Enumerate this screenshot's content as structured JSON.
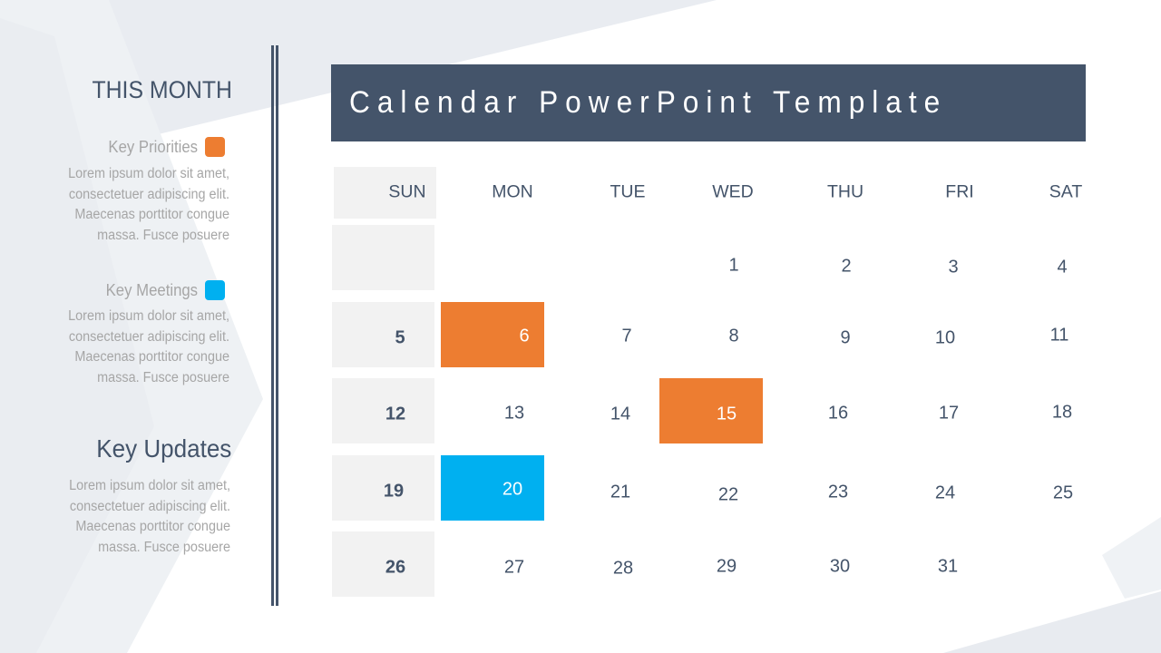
{
  "sidebar": {
    "heading": "THIS MONTH",
    "sections": [
      {
        "title": "Key Priorities",
        "marker_color": "#ed7d31",
        "body_lines": [
          "Lorem ipsum dolor sit amet,",
          "consectetuer adipiscing elit.",
          "Maecenas porttitor congue",
          "massa. Fusce posuere"
        ]
      },
      {
        "title": "Key Meetings",
        "marker_color": "#00b0f0",
        "body_lines": [
          "Lorem ipsum dolor sit amet,",
          "consectetuer adipiscing elit.",
          "Maecenas porttitor congue",
          "massa. Fusce posuere"
        ]
      }
    ],
    "updates": {
      "title": "Key Updates",
      "body_lines": [
        "Lorem ipsum dolor sit amet,",
        "consectetuer adipiscing elit.",
        "Maecenas porttitor congue",
        "massa. Fusce posuere"
      ]
    }
  },
  "banner": {
    "title": "Calendar PowerPoint Template"
  },
  "calendar": {
    "weekdays": [
      "SUN",
      "MON",
      "TUE",
      "WED",
      "THU",
      "FRI",
      "SAT"
    ],
    "weeks": [
      [
        "",
        "",
        "",
        "1",
        "2",
        "3",
        "4"
      ],
      [
        "5",
        "6",
        "7",
        "8",
        "9",
        "10",
        "11"
      ],
      [
        "12",
        "13",
        "14",
        "15",
        "16",
        "17",
        "18"
      ],
      [
        "19",
        "20",
        "21",
        "22",
        "23",
        "24",
        "25"
      ],
      [
        "26",
        "27",
        "28",
        "29",
        "30",
        "31",
        ""
      ]
    ],
    "highlights": [
      {
        "day": "6",
        "type": "priority"
      },
      {
        "day": "15",
        "type": "priority"
      },
      {
        "day": "20",
        "type": "meeting"
      }
    ],
    "colors": {
      "priority": "#ed7d31",
      "meeting": "#00b0f0",
      "sunday_bg": "#f2f2f2",
      "text": "#44546a"
    }
  }
}
